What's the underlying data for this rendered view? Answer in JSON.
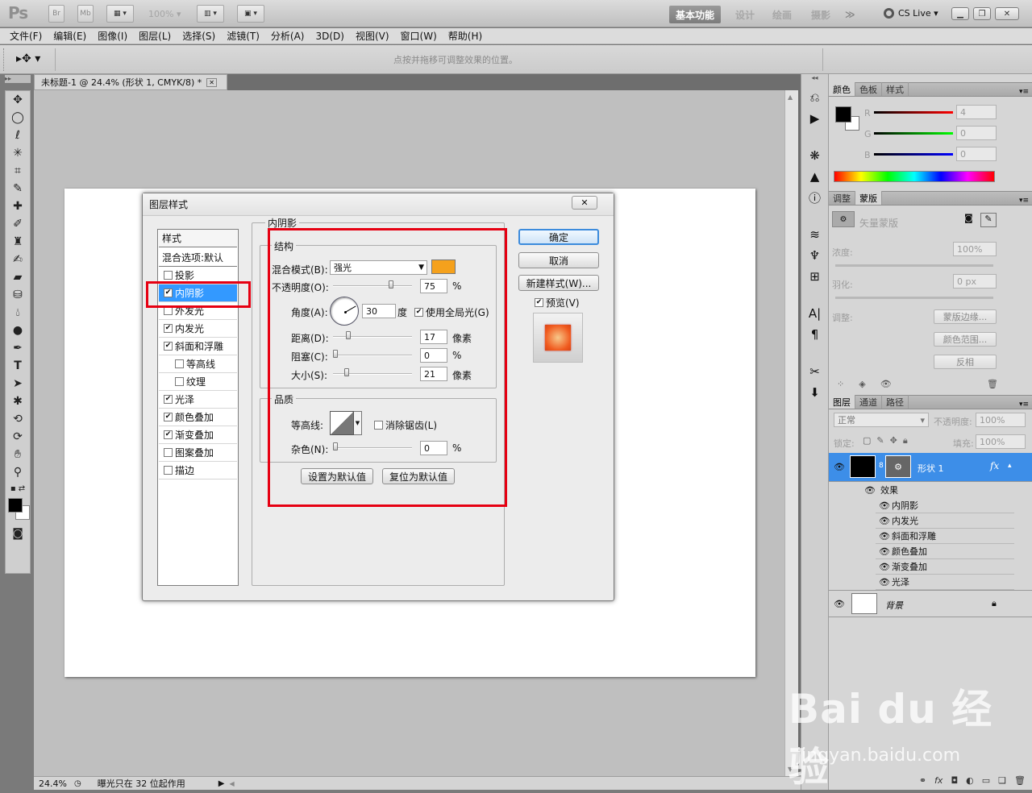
{
  "app": {
    "logo": "Ps",
    "br": "Br",
    "mb": "Mb",
    "zoom_top": "100%",
    "workspaces": [
      "基本功能",
      "设计",
      "绘画",
      "摄影"
    ],
    "more": "≫",
    "cslive": "CS Live"
  },
  "menu": [
    "文件(F)",
    "编辑(E)",
    "图像(I)",
    "图层(L)",
    "选择(S)",
    "滤镜(T)",
    "分析(A)",
    "3D(D)",
    "视图(V)",
    "窗口(W)",
    "帮助(H)"
  ],
  "options": {
    "hint": "点按并拖移可调整效果的位置。"
  },
  "document": {
    "tab_title": "未标题-1 @ 24.4% (形状 1, CMYK/8) *",
    "zoom": "24.4%",
    "status": "曝光只在 32 位起作用"
  },
  "dialog": {
    "title": "图层样式",
    "list_header": "样式",
    "blend_default": "混合选项:默认",
    "items": [
      {
        "label": "投影",
        "checked": false
      },
      {
        "label": "内阴影",
        "checked": true
      },
      {
        "label": "外发光",
        "checked": false
      },
      {
        "label": "内发光",
        "checked": true
      },
      {
        "label": "斜面和浮雕",
        "checked": true
      },
      {
        "label": "等高线",
        "checked": false
      },
      {
        "label": "纹理",
        "checked": false
      },
      {
        "label": "光泽",
        "checked": true
      },
      {
        "label": "颜色叠加",
        "checked": true
      },
      {
        "label": "渐变叠加",
        "checked": true
      },
      {
        "label": "图案叠加",
        "checked": false
      },
      {
        "label": "描边",
        "checked": false
      }
    ],
    "section": "内阴影",
    "structure": {
      "title": "结构",
      "blend_mode_label": "混合模式(B):",
      "blend_mode": "强光",
      "shadow_color": "#f5a11c",
      "opacity_label": "不透明度(O):",
      "opacity": "75",
      "opacity_unit": "%",
      "opacity_level": 0.75,
      "angle_label": "角度(A):",
      "angle": "30",
      "angle_unit": "度",
      "global_light_label": "使用全局光(G)",
      "distance_label": "距离(D):",
      "distance": "17",
      "distance_unit": "像素",
      "distance_level": 0.17,
      "choke_label": "阻塞(C):",
      "choke": "0",
      "choke_unit": "%",
      "choke_level": 0,
      "size_label": "大小(S):",
      "size": "21",
      "size_unit": "像素",
      "size_level": 0.15
    },
    "quality": {
      "title": "品质",
      "contour_label": "等高线:",
      "antialias_label": "消除锯齿(L)",
      "noise_label": "杂色(N):",
      "noise": "0",
      "noise_unit": "%",
      "noise_level": 0
    },
    "set_default": "设置为默认值",
    "reset_default": "复位为默认值",
    "ok": "确定",
    "cancel": "取消",
    "new_style": "新建样式(W)...",
    "preview_label": "预览(V)"
  },
  "color_panel": {
    "tabs": [
      "颜色",
      "色板",
      "样式"
    ],
    "r_label": "R",
    "g_label": "G",
    "b_label": "B",
    "r": "4",
    "g": "0",
    "b": "0"
  },
  "adjust_panel": {
    "tabs": [
      "调整",
      "蒙版"
    ],
    "title": "矢量蒙版",
    "density_label": "浓度:",
    "density": "100%",
    "feather_label": "羽化:",
    "feather": "0 px",
    "refine_label": "调整:",
    "mask_edge": "蒙版边缘...",
    "color_range": "颜色范围...",
    "invert": "反相"
  },
  "layers_panel": {
    "tabs": [
      "图层",
      "通道",
      "路径"
    ],
    "blend": "正常",
    "opacity_label": "不透明度:",
    "opacity": "100%",
    "lock_label": "锁定:",
    "fill_label": "填充:",
    "fill": "100%",
    "layer_name": "形状 1",
    "fx": "fx",
    "effects_label": "效果",
    "effects": [
      "内阴影",
      "内发光",
      "斜面和浮雕",
      "颜色叠加",
      "渐变叠加",
      "光泽"
    ],
    "background": "背景"
  },
  "watermark": {
    "brand": "Bai du 经验",
    "url": "jingyan.baidu.com"
  }
}
